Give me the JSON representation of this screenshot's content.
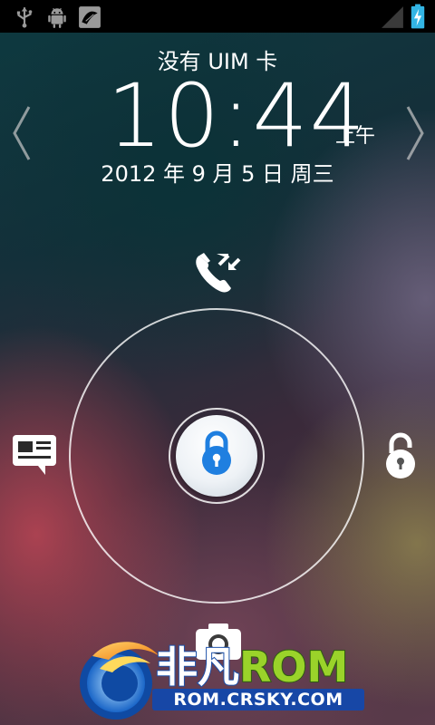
{
  "status_bar": {
    "left_icons": [
      "usb-icon",
      "android-debug-icon",
      "wallpaper-notification-icon"
    ],
    "right_icons": [
      "signal-icon",
      "battery-charging-icon"
    ]
  },
  "lockscreen": {
    "carrier_text": "没有 UIM 卡",
    "time": "10:44",
    "ampm": "上午",
    "date": "2012 年 9 月 5 日 周三",
    "nav": {
      "left_arrow": "chevron-left-icon",
      "right_arrow": "chevron-right-icon"
    },
    "targets": {
      "top": "phone-icon",
      "left": "message-icon",
      "right": "unlock-icon",
      "bottom": "camera-icon",
      "center": "lock-icon"
    },
    "accent_color": "#1f7fe0"
  },
  "watermark": {
    "brand_cn": "非凡",
    "brand_rom": "ROM",
    "url": "ROM.CRSKY.COM"
  }
}
